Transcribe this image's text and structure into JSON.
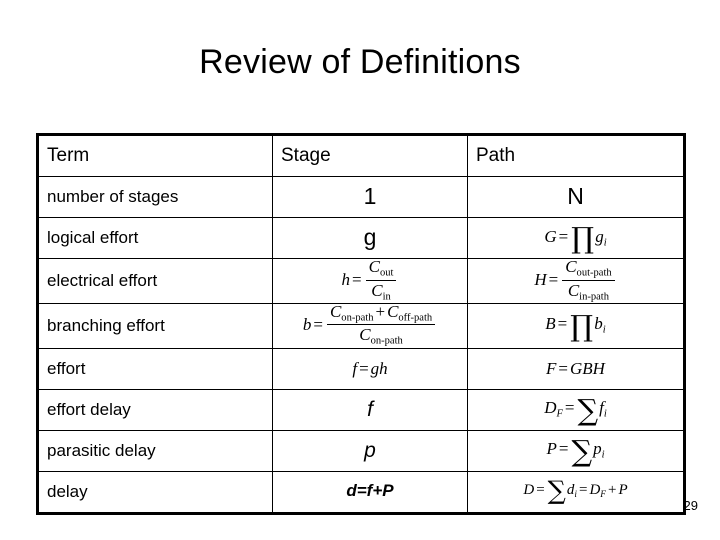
{
  "slide": {
    "title": "Review of Definitions",
    "page_number": "29"
  },
  "table": {
    "headers": [
      "Term",
      "Stage",
      "Path"
    ],
    "rows": [
      {
        "term": "number of stages",
        "stage_text": "1",
        "path_text": "N",
        "stage_kind": "symbol",
        "path_kind": "symbol"
      },
      {
        "term": "logical effort",
        "stage_text": "g",
        "path_text": "G = ∏ gᵢ",
        "stage_kind": "symbol",
        "path_kind": "equation"
      },
      {
        "term": "electrical effort",
        "stage_text": "h = C_out / C_in",
        "path_text": "H = C_out-path / C_in-path",
        "stage_kind": "equation",
        "path_kind": "equation"
      },
      {
        "term": "branching effort",
        "stage_text": "b = (C_on-path + C_off-path) / C_on-path",
        "path_text": "B = ∏ bᵢ",
        "stage_kind": "equation",
        "path_kind": "equation"
      },
      {
        "term": "effort",
        "stage_text": "f = gh",
        "path_text": "F = GBH",
        "stage_kind": "equation",
        "path_kind": "equation"
      },
      {
        "term": "effort delay",
        "stage_text": "f",
        "path_text": "D_F = ∑ fᵢ",
        "stage_kind": "symbol",
        "path_kind": "equation"
      },
      {
        "term": "parasitic delay",
        "stage_text": "p",
        "path_text": "P = ∑ pᵢ",
        "stage_kind": "symbol",
        "path_kind": "equation"
      },
      {
        "term": "delay",
        "stage_text": "d=f+P",
        "path_text": "D = ∑ dᵢ = D_F + P",
        "stage_kind": "symbol",
        "path_kind": "equation"
      }
    ]
  },
  "symbols": {
    "product": "∏",
    "sum": "∑",
    "equals": "=",
    "plus": "+",
    "C": "C",
    "out": "out",
    "in": "in",
    "out_path": "out-path",
    "in_path": "in-path",
    "on_path": "on-path",
    "off_path": "off-path",
    "g": "g",
    "G": "G",
    "h": "h",
    "H": "H",
    "b": "b",
    "B": "B",
    "f": "f",
    "F": "F",
    "p": "p",
    "P": "P",
    "d": "d",
    "D": "D",
    "N": "N",
    "one": "1",
    "i": "i",
    "DF_sub": "F",
    "GBH": "GBH",
    "gh": "gh",
    "d_eq_f_plus_P": "d=f+P"
  }
}
